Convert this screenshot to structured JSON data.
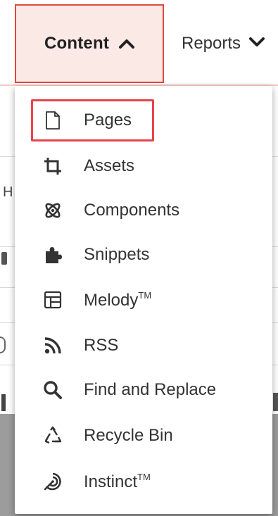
{
  "nav": {
    "content_label": "Content",
    "reports_label": "Reports"
  },
  "background": {
    "fragment_h": "H"
  },
  "menu": {
    "items": [
      {
        "label": "Pages",
        "tm": "",
        "icon": "page-icon"
      },
      {
        "label": "Assets",
        "tm": "",
        "icon": "crop-icon"
      },
      {
        "label": "Components",
        "tm": "",
        "icon": "atom-icon"
      },
      {
        "label": "Snippets",
        "tm": "",
        "icon": "puzzle-icon"
      },
      {
        "label": "Melody",
        "tm": "TM",
        "icon": "layout-icon"
      },
      {
        "label": "RSS",
        "tm": "",
        "icon": "rss-icon"
      },
      {
        "label": "Find and Replace",
        "tm": "",
        "icon": "search-icon"
      },
      {
        "label": "Recycle Bin",
        "tm": "",
        "icon": "recycle-icon"
      },
      {
        "label": "Instinct",
        "tm": "TM",
        "icon": "instinct-icon"
      }
    ]
  },
  "colors": {
    "active_tab_bg": "#fbe9e6",
    "active_tab_border": "#dd4a3c",
    "highlight_border": "#e8434a"
  }
}
